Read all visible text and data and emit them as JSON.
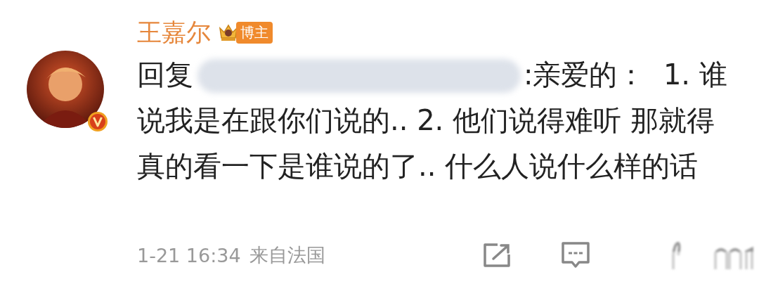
{
  "comment": {
    "author": "王嘉尔",
    "author_badge": "博主",
    "avatar": {
      "kind": "picture",
      "verified": true
    },
    "reply_label": "回复",
    "reply_target_redacted": true,
    "text": ":亲爱的：  1. 谁说我是在跟你们说的.. 2. 他们说得难听 那就得真的看一下是谁说的了.. 什么人说什么样的话",
    "time": "1-21 16:34",
    "source": "来自法国",
    "like_redacted": true
  }
}
